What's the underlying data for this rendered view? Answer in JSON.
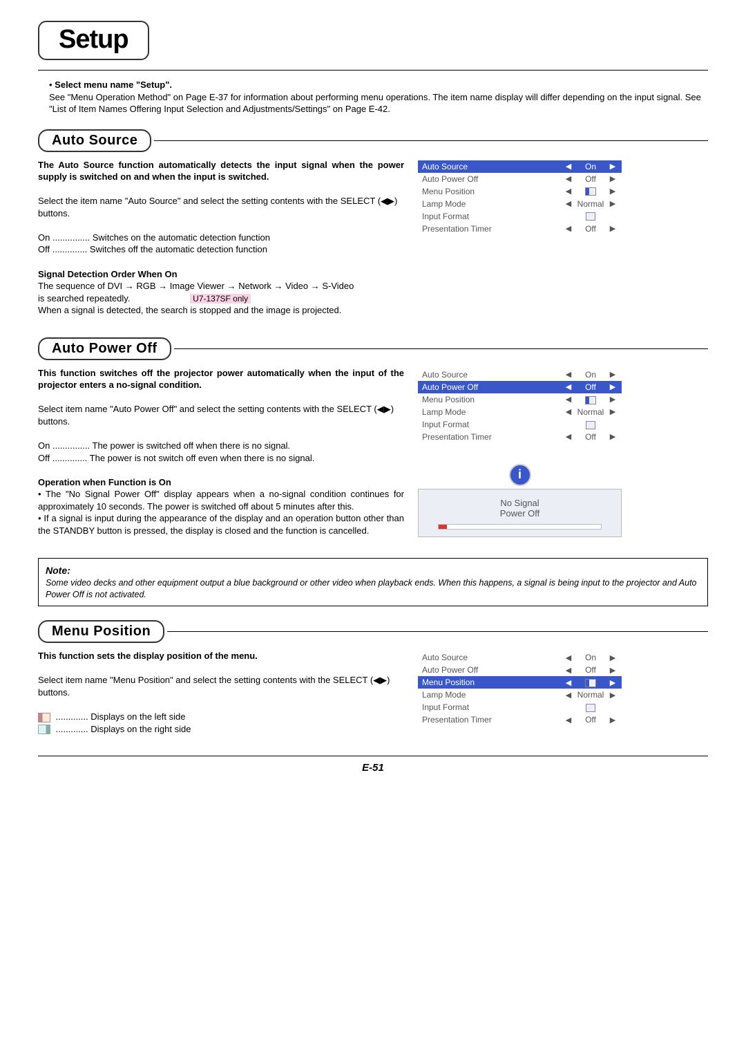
{
  "page_title": "Setup",
  "intro_bullet": "Select menu name \"Setup\".",
  "intro_text": "See \"Menu Operation Method\" on Page E-37 for information about performing menu operations. The item name display will differ depending on the input signal. See \"List of Item Names Offering Input Selection and Adjustments/Settings\" on Page E-42.",
  "sections": {
    "auto_source": {
      "heading": "Auto Source",
      "bold_intro": "The Auto Source function automatically detects the input signal when the power supply is switched on and when the input is switched.",
      "instruction": "Select the item name \"Auto Source\" and select the setting contents with the SELECT (◀▶) buttons.",
      "on_label": "On",
      "on_desc": "Switches on the automatic detection function",
      "off_label": "Off",
      "off_desc": "Switches off the automatic detection function",
      "sig_head": "Signal Detection Order When On",
      "sig_line1": "The sequence of DVI → RGB → Image Viewer → Network → Video → S-Video",
      "sig_line2a": "is searched repeatedly.",
      "model_tag": "U7-137SF only",
      "sig_line3": "When a signal is detected, the search is stopped and the image is projected."
    },
    "auto_power_off": {
      "heading": "Auto Power Off",
      "bold_intro": "This function switches off the projector power automatically when the input of the projector enters a no-signal condition.",
      "instruction": "Select item name \"Auto Power Off\" and select the setting contents with the SELECT (◀▶) buttons.",
      "on_label": "On",
      "on_desc": "The power is switched off when there is no signal.",
      "off_label": "Off",
      "off_desc": "The power is not switch off even when there is no signal.",
      "op_head": "Operation when Function is On",
      "op_b1": "The \"No Signal Power Off\" display appears when a no-signal condition continues for approximately 10 seconds. The power is switched off about 5 minutes after this.",
      "op_b2": "If a signal is input during the appearance of the display and an operation button other than the STANDBY button is pressed, the display is closed and the function is cancelled.",
      "nosignal_l1": "No Signal",
      "nosignal_l2": "Power Off"
    },
    "menu_position": {
      "heading": "Menu Position",
      "bold_intro": "This function sets the display position of the menu.",
      "instruction": "Select item name \"Menu Position\" and select the setting contents with the SELECT (◀▶) buttons.",
      "left_desc": "Displays on the left side",
      "right_desc": "Displays on the right side"
    }
  },
  "note": {
    "head": "Note:",
    "body": "Some video decks and other equipment output a blue background or other video when playback ends. When this happens, a signal is being input to the projector and Auto Power Off is not activated."
  },
  "menu_items": [
    {
      "label": "Auto Source",
      "value": "On"
    },
    {
      "label": "Auto Power Off",
      "value": "Off"
    },
    {
      "label": "Menu Position",
      "value": "pos-icon"
    },
    {
      "label": "Lamp Mode",
      "value": "Normal"
    },
    {
      "label": "Input Format",
      "value": "sel-icon",
      "no_arrows": true
    },
    {
      "label": "Presentation Timer",
      "value": "Off"
    }
  ],
  "page_number": "E-51"
}
